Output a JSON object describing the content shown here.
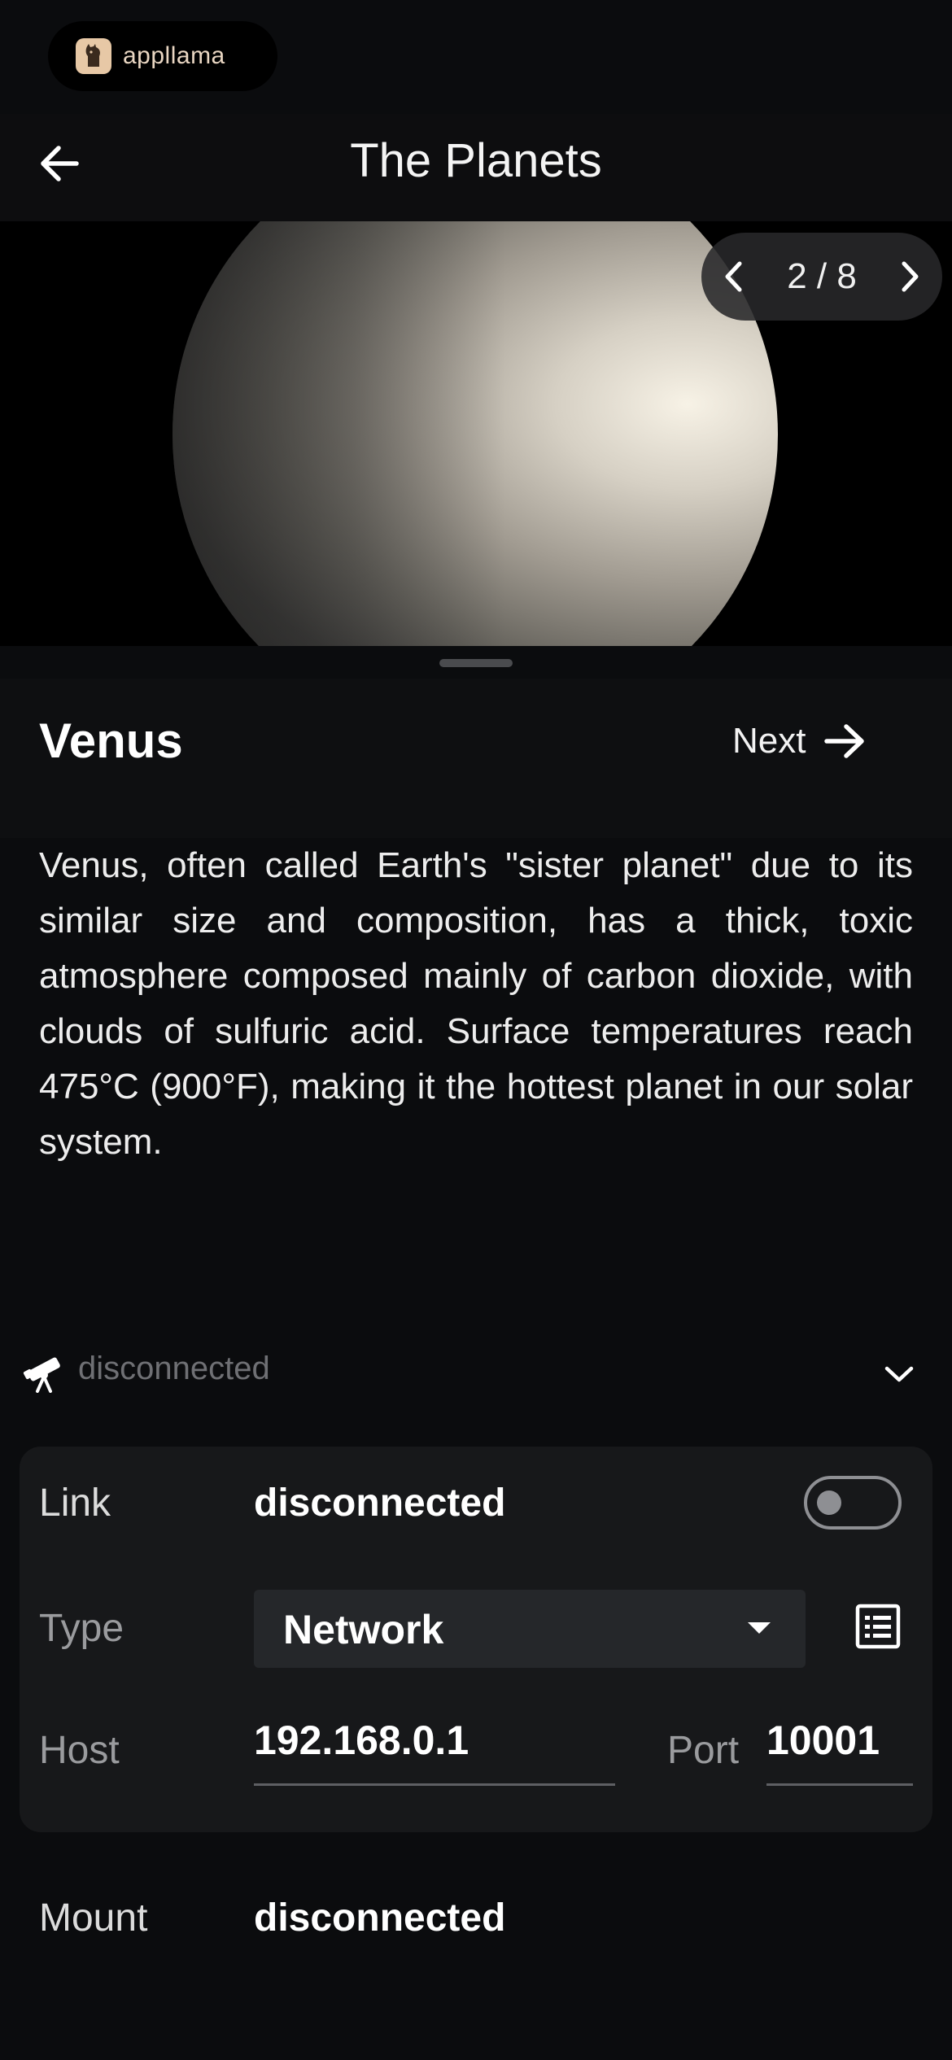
{
  "brand": {
    "name": "appllama"
  },
  "header": {
    "title": "The Planets"
  },
  "pager": {
    "current": 2,
    "total": 8,
    "label": "2 / 8"
  },
  "planet": {
    "name": "Venus",
    "next_label": "Next",
    "description": "Venus, often called Earth's \"sister planet\" due to its similar size and composition, has a thick, toxic atmosphere composed mainly of carbon dioxide, with clouds of sulfuric acid. Surface temperatures reach 475°C (900°F), making it the hottest planet in our solar system."
  },
  "connection": {
    "status": "disconnected",
    "link_label": "Link",
    "link_value": "disconnected",
    "link_enabled": false,
    "type_label": "Type",
    "type_value": "Network",
    "host_label": "Host",
    "host_value": "192.168.0.1",
    "port_label": "Port",
    "port_value": "10001",
    "mount_label": "Mount",
    "mount_value": "disconnected"
  },
  "colors": {
    "background": "#0b0c0e",
    "card": "#17181a",
    "accent": "#ffffff"
  }
}
